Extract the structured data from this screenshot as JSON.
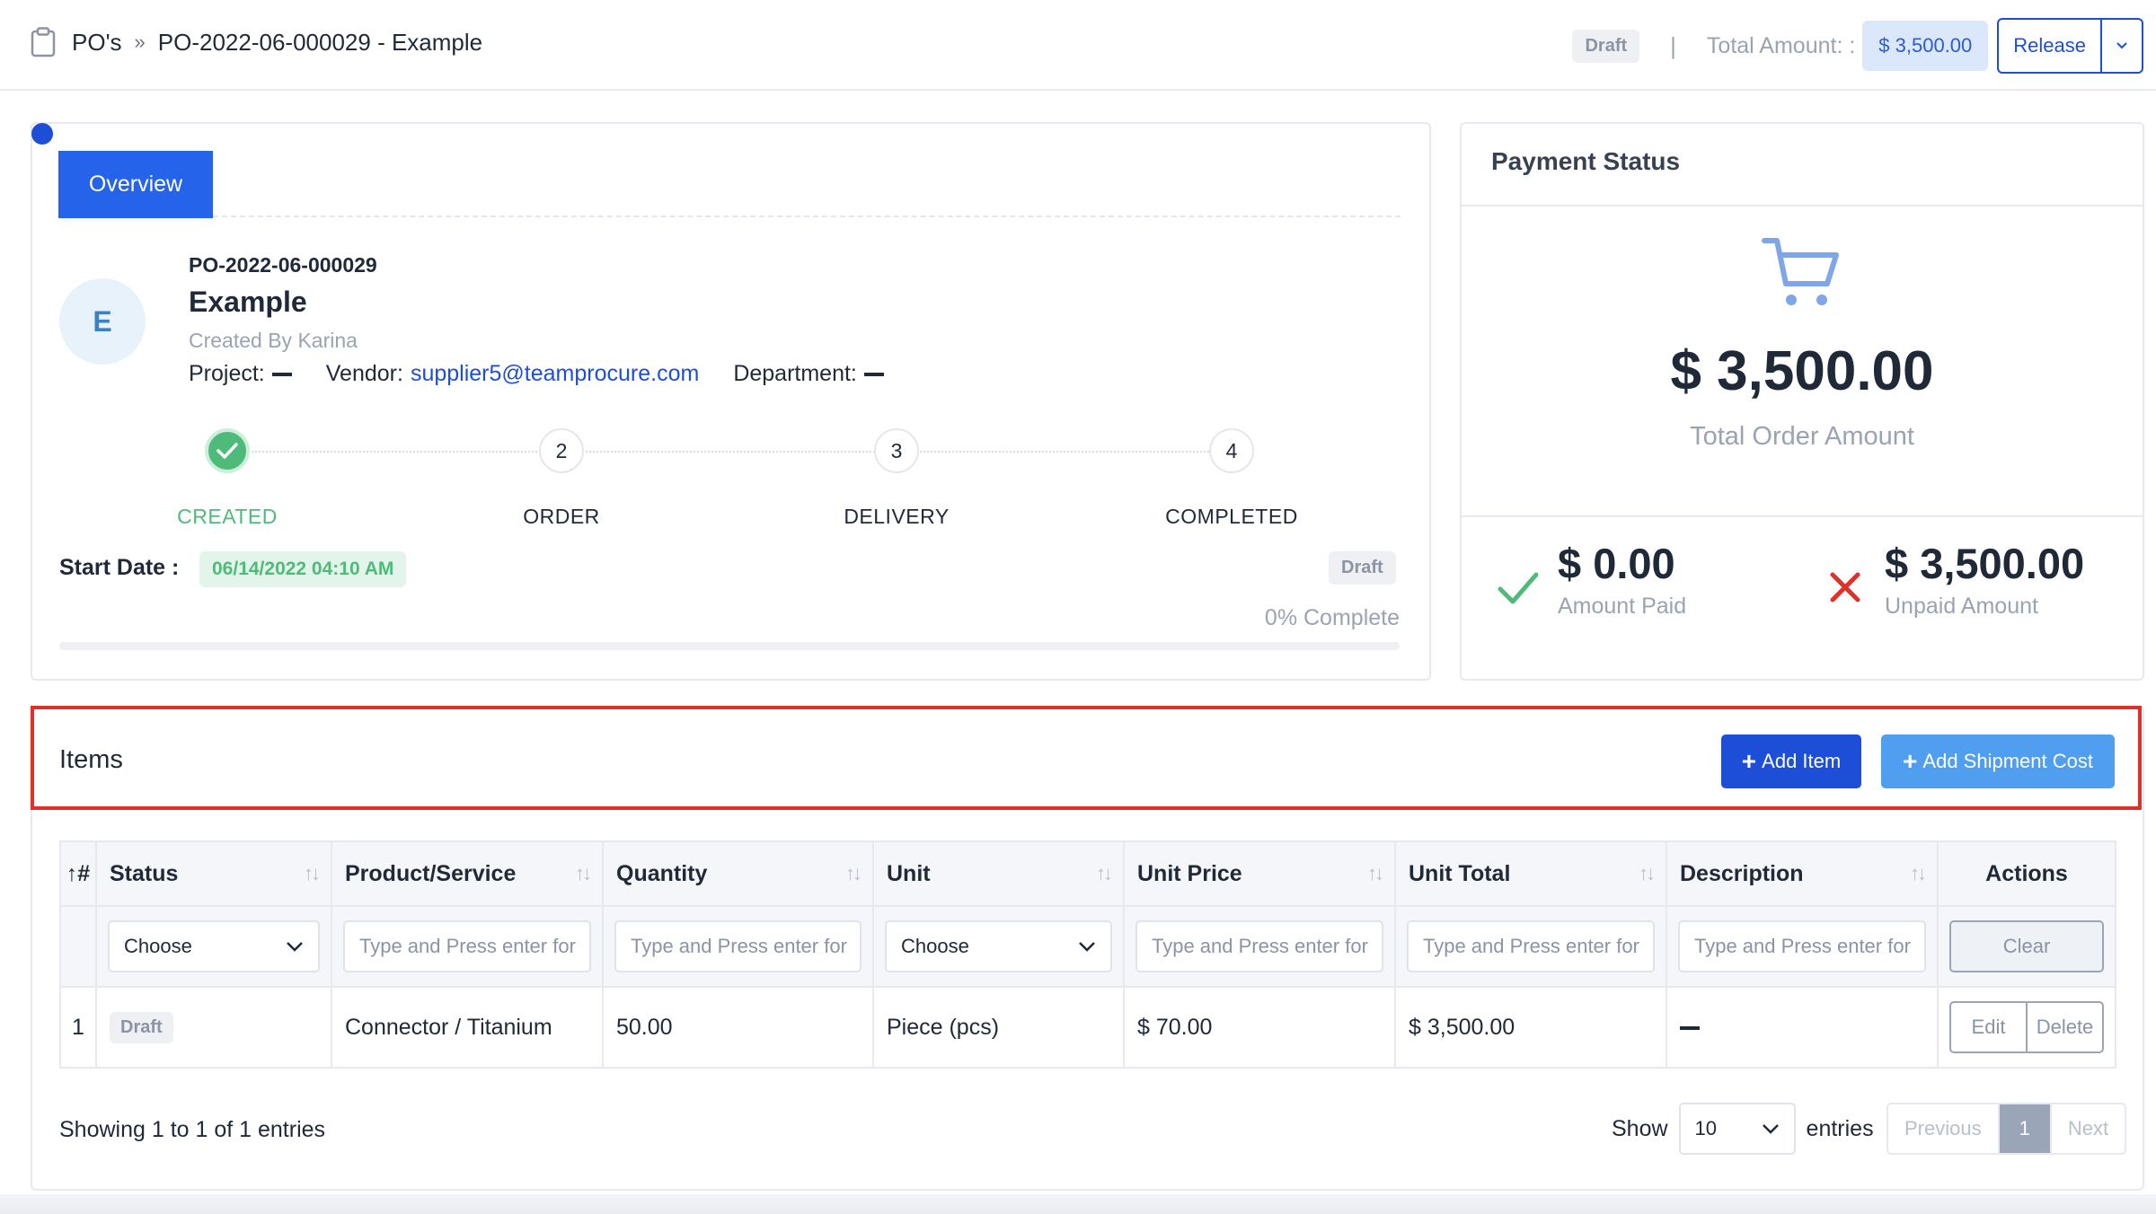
{
  "header": {
    "breadcrumb_root": "PO's",
    "breadcrumb_sep": "»",
    "breadcrumb_current": "PO-2022-06-000029 - Example",
    "status_badge": "Draft",
    "divider": "|",
    "total_label": "Total Amount: :",
    "total_value": "$ 3,500.00",
    "release_label": "Release"
  },
  "overview": {
    "tab_label": "Overview",
    "avatar_letter": "E",
    "po_number": "PO-2022-06-000029",
    "name": "Example",
    "created_by": "Created By Karina",
    "project_label": "Project:",
    "vendor_label": "Vendor:",
    "vendor_value": "supplier5@teamprocure.com",
    "department_label": "Department:",
    "steps": [
      {
        "number": "",
        "label": "CREATED"
      },
      {
        "number": "2",
        "label": "ORDER"
      },
      {
        "number": "3",
        "label": "DELIVERY"
      },
      {
        "number": "4",
        "label": "COMPLETED"
      }
    ],
    "start_date_label": "Start Date :",
    "start_date_value": "06/14/2022 04:10 AM",
    "status_badge": "Draft",
    "progress_text": "0% Complete",
    "progress_fraction": 0
  },
  "payment": {
    "title": "Payment Status",
    "total_amount": "$ 3,500.00",
    "total_label": "Total Order Amount",
    "paid_amount": "$ 0.00",
    "paid_label": "Amount Paid",
    "unpaid_amount": "$ 3,500.00",
    "unpaid_label": "Unpaid Amount"
  },
  "items": {
    "title": "Items",
    "add_item_label": "Add Item",
    "add_shipment_label": "Add Shipment Cost",
    "columns": [
      "#",
      "Status",
      "Product/Service",
      "Quantity",
      "Unit",
      "Unit Price",
      "Unit Total",
      "Description",
      "Actions"
    ],
    "filters": {
      "status": "Choose",
      "unit": "Choose",
      "text_placeholder": "Type and Press enter for",
      "clear_label": "Clear"
    },
    "rows": [
      {
        "index": "1",
        "status": "Draft",
        "product": "Connector / Titanium",
        "quantity": "50.00",
        "unit": "Piece (pcs)",
        "unit_price": "$ 70.00",
        "unit_total": "$ 3,500.00",
        "edit_label": "Edit",
        "delete_label": "Delete"
      }
    ],
    "showing_text": "Showing 1 to 1 of 1 entries",
    "show_label": "Show",
    "page_length": "10",
    "entries_label": "entries",
    "pager": {
      "previous": "Previous",
      "current": "1",
      "next": "Next"
    }
  },
  "colors": {
    "primary": "#1d4ed8",
    "accent_light": "#4f9ef0",
    "success": "#4fbb7a",
    "danger": "#e0302a"
  }
}
